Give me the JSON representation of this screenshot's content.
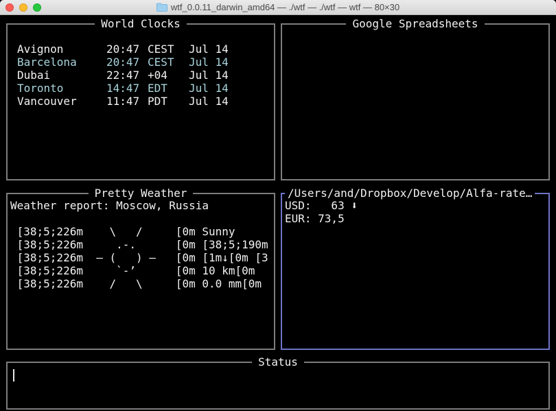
{
  "window": {
    "title": "wtf_0.0.11_darwin_amd64 — ./wtf — ./wtf — wtf — 80×30"
  },
  "world_clocks": {
    "title": "World Clocks",
    "rows": [
      {
        "city": "Avignon",
        "time": "20:47",
        "tz": "CEST",
        "date": "Jul 14"
      },
      {
        "city": "Barcelona",
        "time": "20:47",
        "tz": "CEST",
        "date": "Jul 14"
      },
      {
        "city": "Dubai",
        "time": "22:47",
        "tz": "+04",
        "date": "Jul 14"
      },
      {
        "city": "Toronto",
        "time": "14:47",
        "tz": "EDT",
        "date": "Jul 14"
      },
      {
        "city": "Vancouver",
        "time": "11:47",
        "tz": "PDT",
        "date": "Jul 14"
      }
    ]
  },
  "google_spreadsheets": {
    "title": "Google Spreadsheets"
  },
  "pretty_weather": {
    "title": "Pretty Weather",
    "header": "Weather report: Moscow, Russia",
    "lines": [
      " [38;5;226m    \\   /     [0m Sunny",
      " [38;5;226m     .-.      [0m [38;5;190m",
      " [38;5;226m  ― (   ) ―   [0m [1m↓[0m [3",
      " [38;5;226m     `-’      [0m 10 km[0m",
      " [38;5;226m    /   \\     [0m 0.0 mm[0m"
    ]
  },
  "alfa_rate": {
    "title": "/Users/and/Dropbox/Develop/Alfa-rate…",
    "lines": [
      "USD:   63 ⬇",
      "EUR: 73,5"
    ]
  },
  "status": {
    "title": "Status",
    "text": ""
  }
}
